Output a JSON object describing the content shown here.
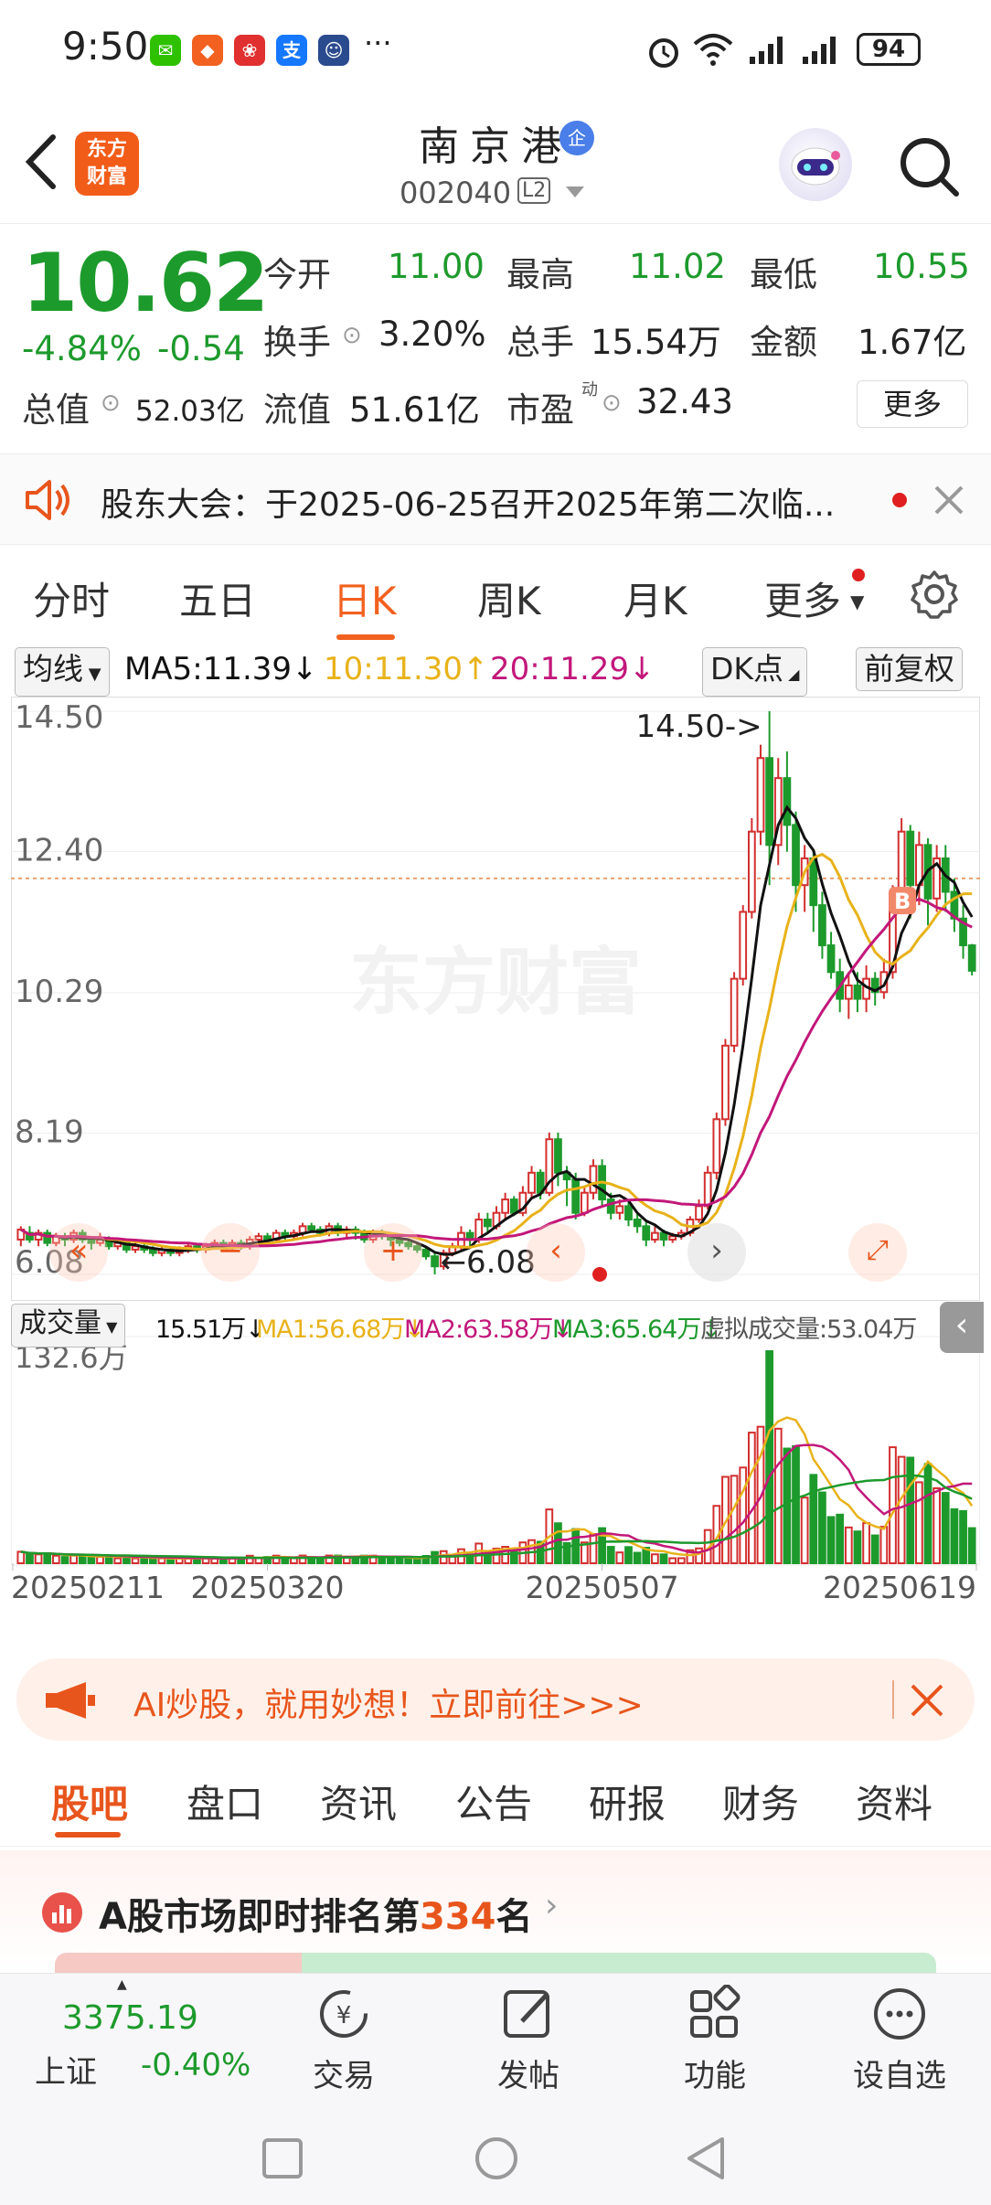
{
  "status_bar": {
    "time": "9:50",
    "battery": "94",
    "more_dots": "···"
  },
  "header": {
    "logo_text_line1": "东方",
    "logo_text_line2": "财富",
    "stock_name": "南京港",
    "badge": "企",
    "stock_code": "002040",
    "level_badge": "L2"
  },
  "quote": {
    "price": "10.62",
    "change_pct": "-4.84%",
    "change_abs": "-0.54",
    "open_label": "今开",
    "open": "11.00",
    "high_label": "最高",
    "high": "11.02",
    "low_label": "最低",
    "low": "10.55",
    "turnover_label": "换手",
    "turnover": "3.20%",
    "volume_label": "总手",
    "volume": "15.54万",
    "amount_label": "金额",
    "amount": "1.67亿",
    "total_cap_label": "总值",
    "total_cap": "52.03亿",
    "float_cap_label": "流值",
    "float_cap": "51.61亿",
    "pe_label": "市盈",
    "pe_sup": "动",
    "pe": "32.43",
    "more_button": "更多"
  },
  "notice": {
    "text": "股东大会：于2025-06-25召开2025年第二次临..."
  },
  "tabs": [
    "分时",
    "五日",
    "日K",
    "周K",
    "月K",
    "更多"
  ],
  "active_tab": "日K",
  "ma_legend": {
    "selector": "均线",
    "ma5": "MA5:11.39↓",
    "ma10": "10:11.30↑",
    "ma20": "20:11.29↓",
    "dk": "DK点",
    "adjust": "前复权"
  },
  "colors": {
    "up": "#d32f2f",
    "down": "#1d9a2c",
    "ma5": "#111111",
    "ma10": "#e8b21a",
    "ma20": "#c2187a",
    "accent": "#f2611f"
  },
  "chart_data": {
    "type": "candlestick",
    "y_ticks": [
      "14.50",
      "12.40",
      "10.29",
      "8.19",
      "6.08"
    ],
    "ylim": [
      6.08,
      14.5
    ],
    "max_marker": "14.50->",
    "min_marker": "←6.08",
    "current_price_line": 12.0,
    "x_ticks": [
      "20250211",
      "20250320",
      "20250507",
      "20250619"
    ],
    "b_marker": "B",
    "candles": [
      [
        6.6,
        6.75,
        6.5,
        6.8
      ],
      [
        6.7,
        6.6,
        6.55,
        6.8
      ],
      [
        6.6,
        6.7,
        6.5,
        6.75
      ],
      [
        6.7,
        6.55,
        6.5,
        6.75
      ],
      [
        6.55,
        6.65,
        6.5,
        6.7
      ],
      [
        6.65,
        6.6,
        6.5,
        6.7
      ],
      [
        6.6,
        6.7,
        6.55,
        6.75
      ],
      [
        6.7,
        6.6,
        6.55,
        6.75
      ],
      [
        6.6,
        6.55,
        6.45,
        6.65
      ],
      [
        6.55,
        6.6,
        6.5,
        6.7
      ],
      [
        6.6,
        6.5,
        6.45,
        6.65
      ],
      [
        6.5,
        6.55,
        6.45,
        6.6
      ],
      [
        6.55,
        6.45,
        6.4,
        6.6
      ],
      [
        6.45,
        6.5,
        6.4,
        6.55
      ],
      [
        6.5,
        6.45,
        6.4,
        6.55
      ],
      [
        6.45,
        6.4,
        6.35,
        6.5
      ],
      [
        6.4,
        6.45,
        6.35,
        6.5
      ],
      [
        6.45,
        6.4,
        6.35,
        6.5
      ],
      [
        6.4,
        6.45,
        6.35,
        6.5
      ],
      [
        6.45,
        6.5,
        6.4,
        6.55
      ],
      [
        6.5,
        6.45,
        6.4,
        6.55
      ],
      [
        6.45,
        6.5,
        6.4,
        6.55
      ],
      [
        6.5,
        6.55,
        6.45,
        6.6
      ],
      [
        6.55,
        6.5,
        6.45,
        6.6
      ],
      [
        6.5,
        6.55,
        6.45,
        6.6
      ],
      [
        6.55,
        6.5,
        6.45,
        6.6
      ],
      [
        6.5,
        6.6,
        6.45,
        6.65
      ],
      [
        6.6,
        6.65,
        6.55,
        6.7
      ],
      [
        6.65,
        6.6,
        6.5,
        6.7
      ],
      [
        6.6,
        6.7,
        6.55,
        6.75
      ],
      [
        6.7,
        6.65,
        6.6,
        6.75
      ],
      [
        6.65,
        6.7,
        6.6,
        6.75
      ],
      [
        6.7,
        6.8,
        6.65,
        6.85
      ],
      [
        6.8,
        6.75,
        6.7,
        6.85
      ],
      [
        6.75,
        6.7,
        6.65,
        6.8
      ],
      [
        6.7,
        6.8,
        6.65,
        6.85
      ],
      [
        6.8,
        6.7,
        6.65,
        6.85
      ],
      [
        6.7,
        6.75,
        6.6,
        6.8
      ],
      [
        6.75,
        6.7,
        6.6,
        6.8
      ],
      [
        6.7,
        6.6,
        6.55,
        6.75
      ],
      [
        6.6,
        6.7,
        6.55,
        6.75
      ],
      [
        6.7,
        6.65,
        6.6,
        6.75
      ],
      [
        6.65,
        6.6,
        6.5,
        6.7
      ],
      [
        6.6,
        6.55,
        6.5,
        6.65
      ],
      [
        6.55,
        6.5,
        6.45,
        6.6
      ],
      [
        6.5,
        6.45,
        6.4,
        6.55
      ],
      [
        6.45,
        6.35,
        6.3,
        6.5
      ],
      [
        6.35,
        6.2,
        6.08,
        6.4
      ],
      [
        6.2,
        6.4,
        6.15,
        6.45
      ],
      [
        6.4,
        6.5,
        6.35,
        6.55
      ],
      [
        6.5,
        6.7,
        6.45,
        6.8
      ],
      [
        6.7,
        6.6,
        6.5,
        6.75
      ],
      [
        6.6,
        6.9,
        6.55,
        7.0
      ],
      [
        6.9,
        6.8,
        6.7,
        7.0
      ],
      [
        6.8,
        7.0,
        6.75,
        7.1
      ],
      [
        7.0,
        7.2,
        6.9,
        7.3
      ],
      [
        7.2,
        7.0,
        6.95,
        7.25
      ],
      [
        7.0,
        7.3,
        6.95,
        7.4
      ],
      [
        7.3,
        7.6,
        7.2,
        7.7
      ],
      [
        7.6,
        7.3,
        7.2,
        7.65
      ],
      [
        7.3,
        8.1,
        7.25,
        8.2
      ],
      [
        8.1,
        7.6,
        7.4,
        8.2
      ],
      [
        7.6,
        7.5,
        7.1,
        7.7
      ],
      [
        7.5,
        7.0,
        6.9,
        7.6
      ],
      [
        7.0,
        7.3,
        6.95,
        7.4
      ],
      [
        7.3,
        7.7,
        7.2,
        7.8
      ],
      [
        7.7,
        7.2,
        7.1,
        7.8
      ],
      [
        7.2,
        7.0,
        6.9,
        7.3
      ],
      [
        7.0,
        7.1,
        6.9,
        7.2
      ],
      [
        7.1,
        6.9,
        6.8,
        7.2
      ],
      [
        6.9,
        6.8,
        6.7,
        7.0
      ],
      [
        6.8,
        6.6,
        6.5,
        6.9
      ],
      [
        6.6,
        6.7,
        6.55,
        6.8
      ],
      [
        6.7,
        6.6,
        6.5,
        6.75
      ],
      [
        6.6,
        6.65,
        6.55,
        6.7
      ],
      [
        6.65,
        6.7,
        6.6,
        6.75
      ],
      [
        6.7,
        6.9,
        6.65,
        6.95
      ],
      [
        6.9,
        7.1,
        6.85,
        7.2
      ],
      [
        7.1,
        7.6,
        7.05,
        7.7
      ],
      [
        7.6,
        8.4,
        7.5,
        8.5
      ],
      [
        8.4,
        9.5,
        8.3,
        9.6
      ],
      [
        9.5,
        10.5,
        9.4,
        10.6
      ],
      [
        10.5,
        11.5,
        10.4,
        11.6
      ],
      [
        11.5,
        12.7,
        11.4,
        12.9
      ],
      [
        12.7,
        13.8,
        12.5,
        14.0
      ],
      [
        13.8,
        12.5,
        11.9,
        14.5
      ],
      [
        12.5,
        13.5,
        12.2,
        13.8
      ],
      [
        13.5,
        12.8,
        12.4,
        13.9
      ],
      [
        12.8,
        11.9,
        11.5,
        13.0
      ],
      [
        11.9,
        12.3,
        11.5,
        12.5
      ],
      [
        12.3,
        11.6,
        11.2,
        12.4
      ],
      [
        11.6,
        11.0,
        10.8,
        11.8
      ],
      [
        11.0,
        10.6,
        10.5,
        11.2
      ],
      [
        10.6,
        10.2,
        10.0,
        10.8
      ],
      [
        10.2,
        10.4,
        9.9,
        10.6
      ],
      [
        10.4,
        10.2,
        10.0,
        10.6
      ],
      [
        10.2,
        10.5,
        10.0,
        10.7
      ],
      [
        10.5,
        10.3,
        10.1,
        10.6
      ],
      [
        10.3,
        10.6,
        10.2,
        10.8
      ],
      [
        10.6,
        11.8,
        10.5,
        11.9
      ],
      [
        11.8,
        12.7,
        11.6,
        12.9
      ],
      [
        12.7,
        11.9,
        11.4,
        12.8
      ],
      [
        11.9,
        12.5,
        11.6,
        12.7
      ],
      [
        12.5,
        11.7,
        11.3,
        12.6
      ],
      [
        11.7,
        12.3,
        11.5,
        12.5
      ],
      [
        12.3,
        11.8,
        11.5,
        12.5
      ],
      [
        11.8,
        11.4,
        11.2,
        12.0
      ],
      [
        11.4,
        11.0,
        10.8,
        11.6
      ],
      [
        11.0,
        10.62,
        10.55,
        11.02
      ]
    ],
    "volume": {
      "label": "成交量",
      "current": "15.51万↓",
      "ma1": "MA1:56.68万↓",
      "ma2": "MA2:63.58万↓",
      "ma3": "MA3:65.64万↓",
      "virtual": "虚拟成交量:53.04万",
      "max_tick": "132.6万"
    }
  },
  "ai_banner": {
    "text": "AI炒股，就用妙想！立即前往>>>"
  },
  "bottom_tabs": [
    "股吧",
    "盘口",
    "资讯",
    "公告",
    "研报",
    "财务",
    "资料"
  ],
  "rank": {
    "prefix": "A股市场即时排名第",
    "number": "334",
    "suffix": "名"
  },
  "bottom_nav": {
    "index_value": "3375.19",
    "index_name": "上证",
    "index_change": "-0.40%",
    "items": [
      "交易",
      "发帖",
      "功能",
      "设自选"
    ]
  }
}
